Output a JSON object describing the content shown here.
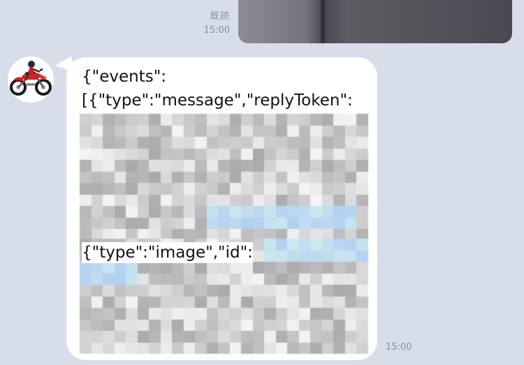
{
  "sent_message": {
    "read_label": "既読",
    "time": "15:00"
  },
  "received_message": {
    "lines": [
      "{\"events\":",
      "[{\"type\":\"message\",\"replyToken\":",
      "{\"type\":\"image\",\"id\":"
    ],
    "time": "15:00"
  },
  "colors": {
    "chat_background": "#d7dde9",
    "bubble": "#ffffff",
    "meta_text": "#8a8f9b",
    "link_blur": "#b9d6f3"
  }
}
